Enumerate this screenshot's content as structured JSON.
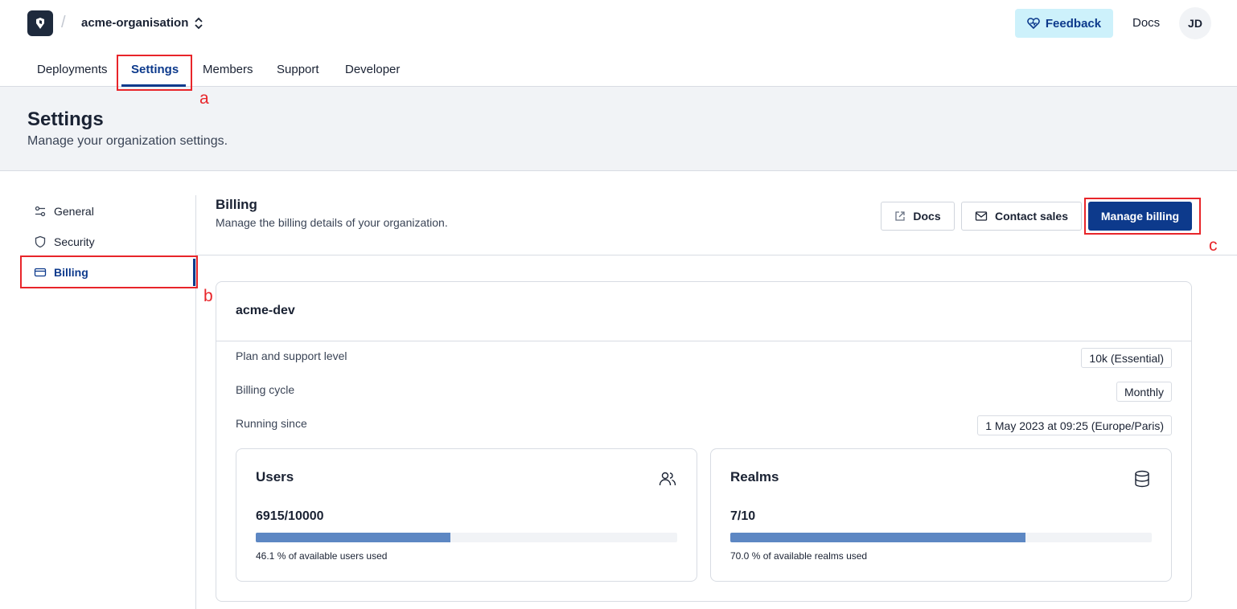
{
  "header": {
    "org_name": "acme-organisation",
    "feedback_label": "Feedback",
    "docs_label": "Docs",
    "avatar_initials": "JD"
  },
  "tabs": [
    {
      "label": "Deployments"
    },
    {
      "label": "Settings",
      "active": true
    },
    {
      "label": "Members"
    },
    {
      "label": "Support"
    },
    {
      "label": "Developer"
    }
  ],
  "page": {
    "title": "Settings",
    "subtitle": "Manage your organization settings."
  },
  "sidenav": {
    "items": [
      {
        "label": "General",
        "icon": "sliders-icon"
      },
      {
        "label": "Security",
        "icon": "shield-icon"
      },
      {
        "label": "Billing",
        "icon": "credit-card-icon",
        "active": true
      }
    ]
  },
  "billing": {
    "title": "Billing",
    "subtitle": "Manage the billing details of your organization.",
    "docs_label": "Docs",
    "contact_label": "Contact sales",
    "manage_label": "Manage billing"
  },
  "deployment": {
    "name": "acme-dev",
    "rows": [
      {
        "label": "Plan and support level",
        "value": "10k (Essential)"
      },
      {
        "label": "Billing cycle",
        "value": "Monthly"
      },
      {
        "label": "Running since",
        "value": "1 May 2023 at 09:25 (Europe/Paris)"
      }
    ],
    "users": {
      "title": "Users",
      "count": "6915/10000",
      "percent": 46.1,
      "caption": "46.1 % of available users used"
    },
    "realms": {
      "title": "Realms",
      "count": "7/10",
      "percent": 70.0,
      "caption": "70.0 % of available realms used"
    }
  },
  "annotations": {
    "a": "a",
    "b": "b",
    "c": "c"
  },
  "colors": {
    "brand": "#0d3a8c",
    "annotation": "#e8252a",
    "feedback_bg": "#cdf1fb",
    "progress": "#5d87c3"
  }
}
